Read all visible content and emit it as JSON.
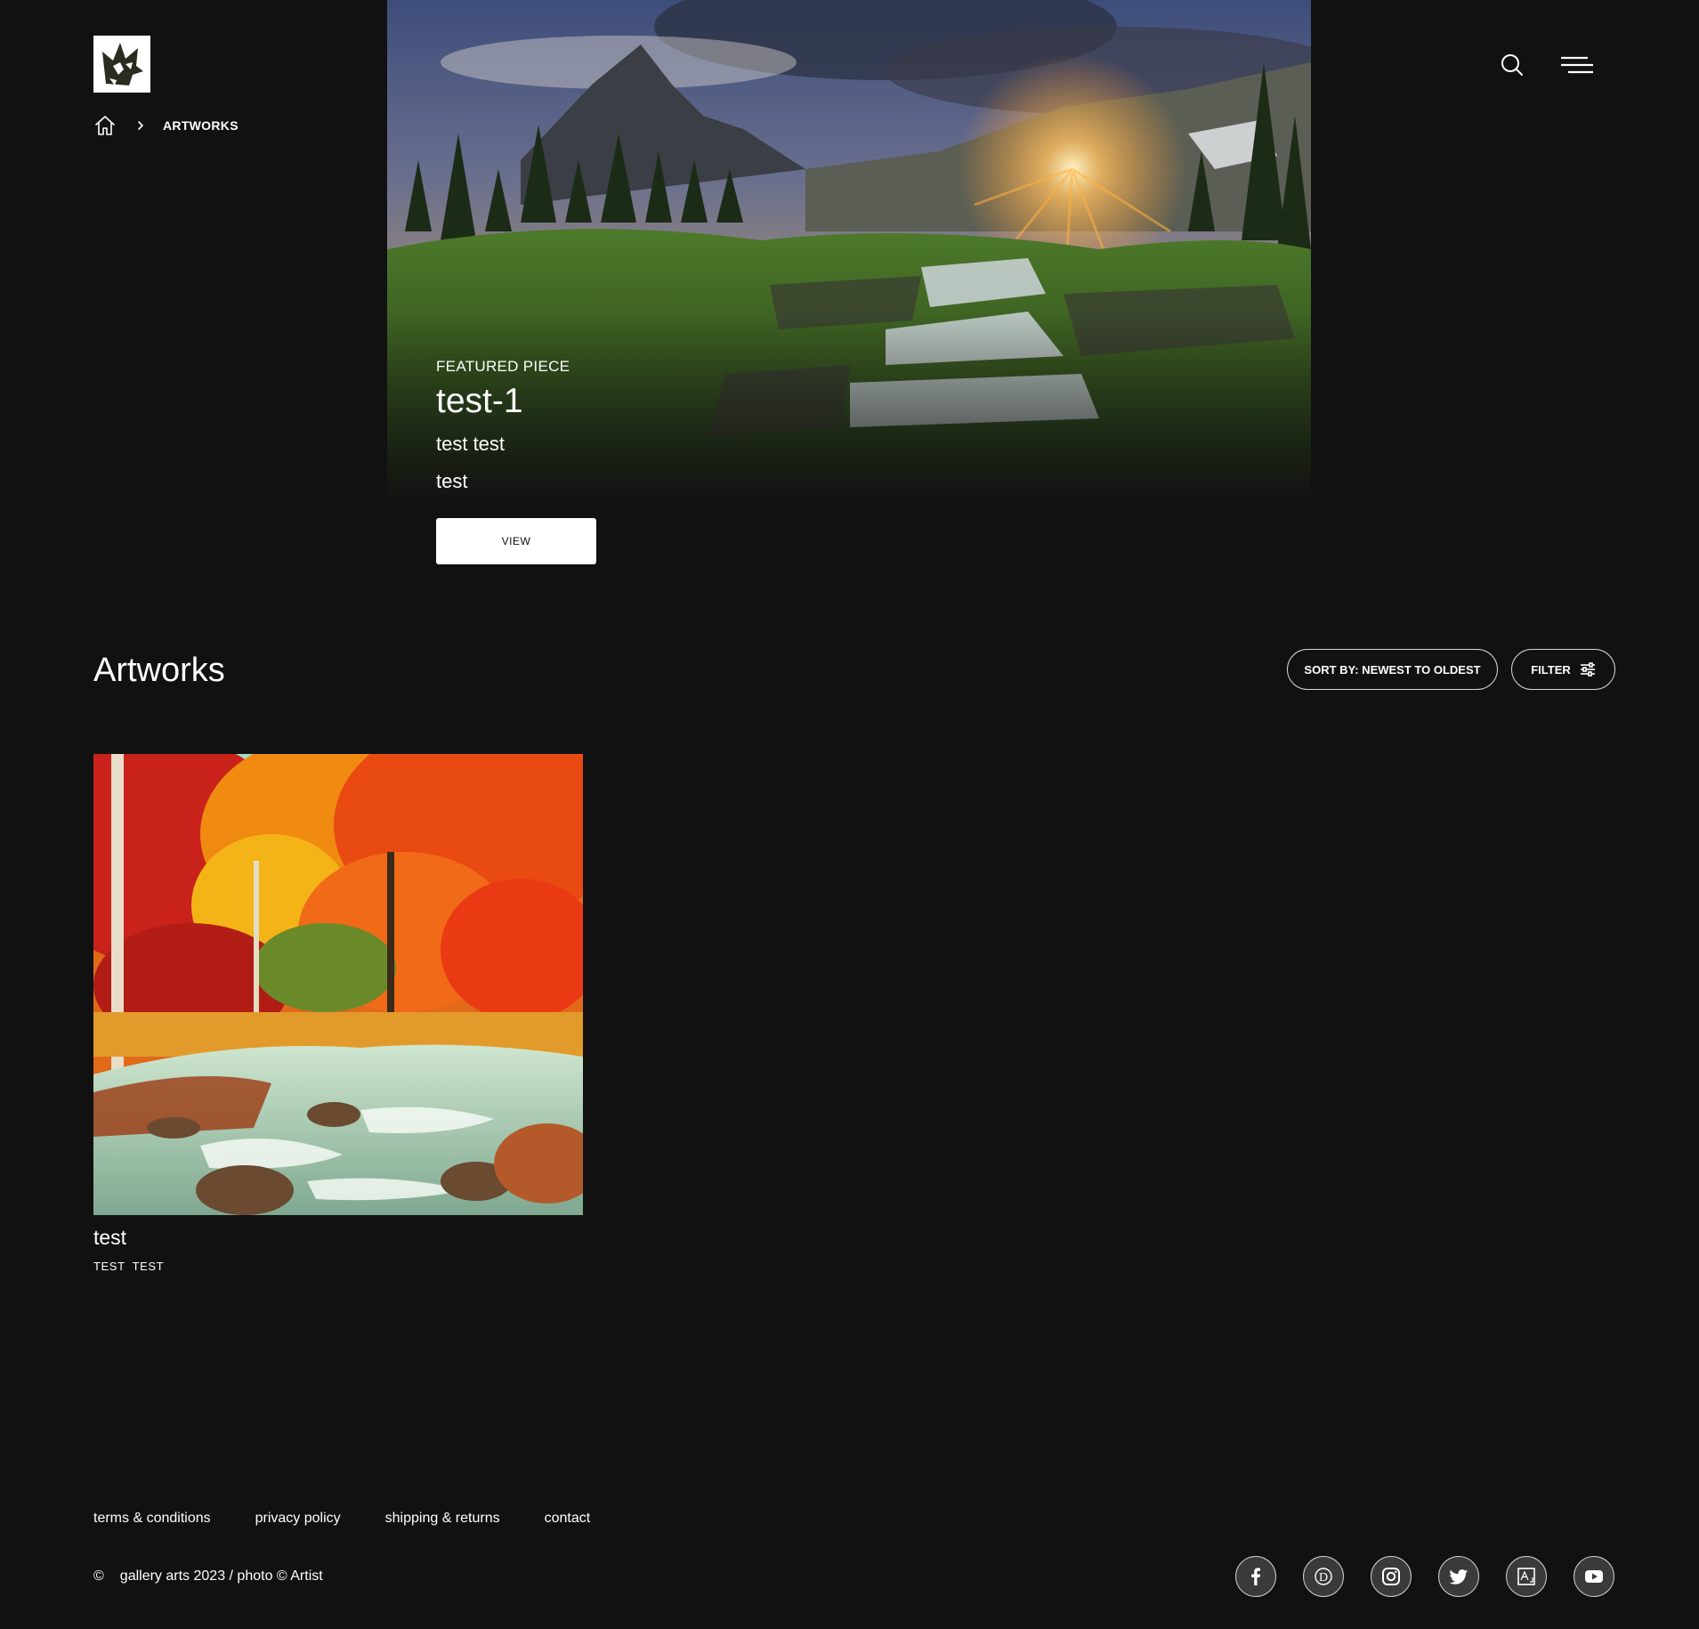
{
  "header": {
    "logo_icon": "wolf-logo",
    "breadcrumb": {
      "home_icon": "home-icon",
      "current": "ARTWORKS"
    },
    "search_icon": "search-icon",
    "menu_icon": "hamburger-menu-icon"
  },
  "hero": {
    "kicker": "FEATURED PIECE",
    "title": "test-1",
    "subtitle": "test test",
    "description": "test",
    "button_label": "VIEW"
  },
  "artworks": {
    "heading": "Artworks",
    "sort_label": "SORT BY: NEWEST TO OLDEST",
    "filter_label": "FILTER",
    "items": [
      {
        "title": "test",
        "artist": "TEST  TEST"
      }
    ]
  },
  "footer": {
    "links": [
      "terms & conditions",
      "privacy policy",
      "shipping & returns",
      "contact"
    ],
    "copyright_symbol": "©",
    "copyright_text": "gallery arts 2023 / photo © Artist",
    "socials": [
      "facebook-icon",
      "deviantart-icon",
      "instagram-icon",
      "twitter-icon",
      "artstation-icon",
      "youtube-icon"
    ]
  },
  "colors": {
    "background": "#111111",
    "text": "#ffffff",
    "button_bg": "#ffffff"
  }
}
